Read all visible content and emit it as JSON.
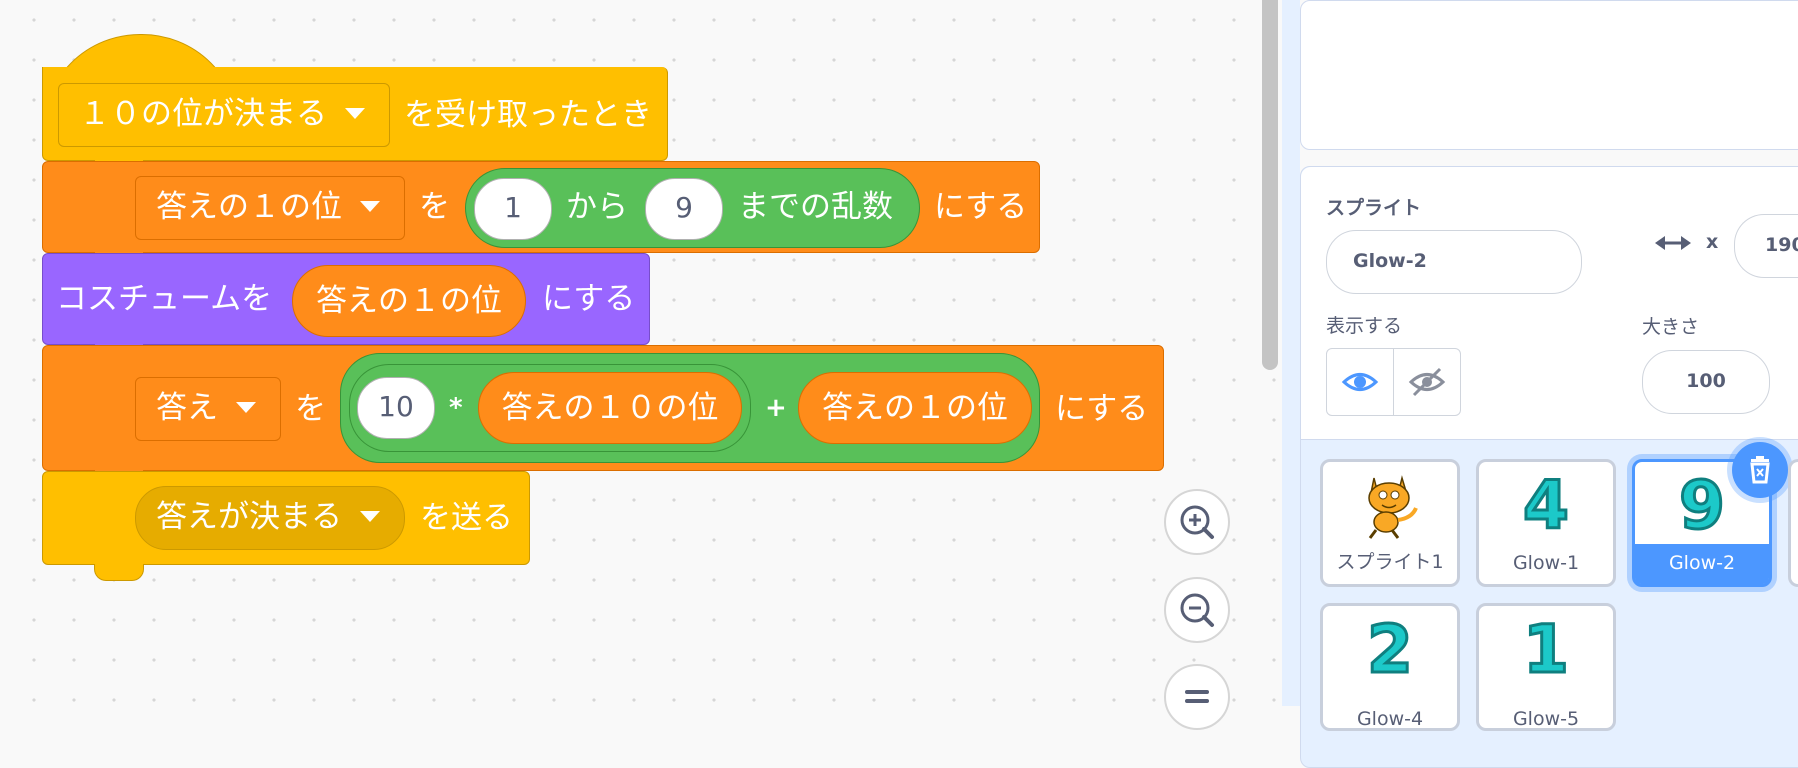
{
  "blocks": {
    "hat": {
      "message_dropdown": "１０の位が決まる",
      "suffix": "を受け取ったとき"
    },
    "set_random": {
      "variable": "答えの１の位",
      "particle": "を",
      "from_value": "1",
      "from_label": "から",
      "to_value": "9",
      "to_label": "までの乱数",
      "suffix": "にする"
    },
    "switch_costume": {
      "prefix": "コスチュームを",
      "reporter": "答えの１の位",
      "suffix": "にする"
    },
    "set_answer": {
      "variable": "答え",
      "particle": "を",
      "multiplier": "10",
      "times_op": "*",
      "tens_reporter": "答えの１０の位",
      "plus_op": "+",
      "ones_reporter": "答えの１の位",
      "suffix": "にする"
    },
    "broadcast": {
      "message_dropdown": "答えが決まる",
      "suffix": "を送る"
    }
  },
  "zoom_controls": [
    "zoom-in",
    "zoom-out",
    "zoom-reset"
  ],
  "sprite_info": {
    "sprite_label": "スプライト",
    "sprite_name": "Glow-2",
    "x_label": "x",
    "x_value": "190",
    "show_label": "表示する",
    "size_label": "大きさ",
    "size_value": "100"
  },
  "sprites": [
    {
      "name": "スプライト1",
      "glyph": ""
    },
    {
      "name": "Glow-1",
      "glyph": "4"
    },
    {
      "name": "Glow-2",
      "glyph": "9"
    },
    {
      "name": "Glow-4",
      "glyph": "2"
    },
    {
      "name": "Glow-5",
      "glyph": "1"
    }
  ],
  "colors": {
    "events": "#ffbf00",
    "variables": "#ff8c1a",
    "operators": "#59c059",
    "looks": "#9966ff",
    "accent": "#4c97ff",
    "glyph": "#1cc9c9"
  }
}
